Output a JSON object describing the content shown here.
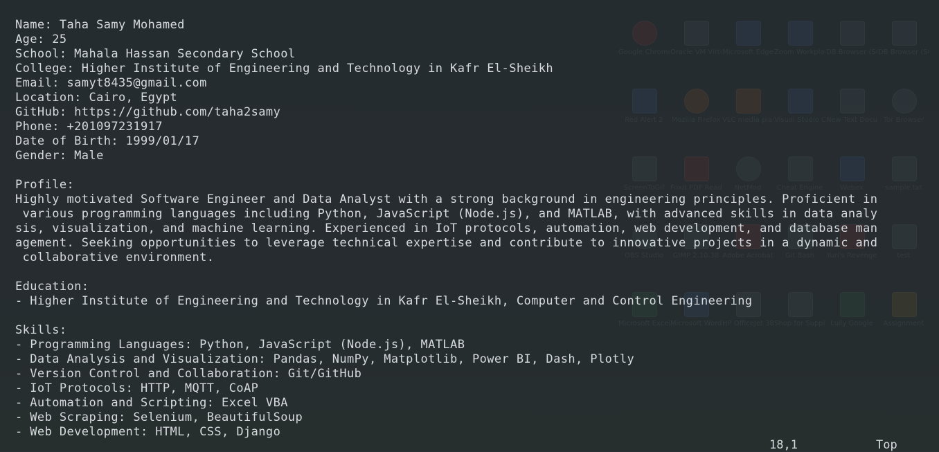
{
  "document": {
    "lines": [
      "Name: Taha Samy Mohamed",
      "Age: 25",
      "School: Mahala Hassan Secondary School",
      "College: Higher Institute of Engineering and Technology in Kafr El-Sheikh",
      "Email: samyt8435@gmail.com",
      "Location: Cairo, Egypt",
      "GitHub: https://github.com/taha2samy",
      "Phone: +201097231917",
      "Date of Birth: 1999/01/17",
      "Gender: Male",
      "",
      "Profile:",
      "Highly motivated Software Engineer and Data Analyst with a strong background in engineering principles. Proficient in",
      " various programming languages including Python, JavaScript (Node.js), and MATLAB, with advanced skills in data analy",
      "sis, visualization, and machine learning. Experienced in IoT protocols, automation, web development, and database man",
      "agement. Seeking opportunities to leverage technical expertise and contribute to innovative projects in a dynamic and",
      " collaborative environment.",
      "",
      "Education:",
      "- Higher Institute of Engineering and Technology in Kafr El-Sheikh, Computer and Control Engineering",
      "",
      "Skills:",
      "- Programming Languages: Python, JavaScript (Node.js), MATLAB",
      "- Data Analysis and Visualization: Pandas, NumPy, Matplotlib, Power BI, Dash, Plotly",
      "- Version Control and Collaboration: Git/GitHub",
      "- IoT Protocols: HTTP, MQTT, CoAP",
      "- Automation and Scripting: Excel VBA",
      "- Web Scraping: Selenium, BeautifulSoup",
      "- Web Development: HTML, CSS, Django"
    ]
  },
  "status": {
    "cursor_position": "18,1",
    "scroll_position": "Top"
  },
  "desktop_icons": [
    {
      "label": "Google Chrome",
      "icon": "chrome-icon",
      "color": "#d9443a"
    },
    {
      "label": "Oracle VM VirtualBox",
      "icon": "virtualbox-icon",
      "color": "#7a8a99"
    },
    {
      "label": "Microsoft Edge",
      "icon": "edge-icon",
      "color": "#2b7fd6"
    },
    {
      "label": "Zoom Workplace",
      "icon": "zoom-icon",
      "color": "#2d8cff"
    },
    {
      "label": "DB Browser (SQLCipher)",
      "icon": "dbbrowser-icon",
      "color": "#8895a0"
    },
    {
      "label": "DB Browser (SQLite)",
      "icon": "dbbrowser-icon",
      "color": "#8895a0"
    },
    {
      "label": "Red Alert 2",
      "icon": "game-icon",
      "color": "#3a6fb0"
    },
    {
      "label": "Mozilla Firefox",
      "icon": "firefox-icon",
      "color": "#e66a1e"
    },
    {
      "label": "VLC media player",
      "icon": "vlc-icon",
      "color": "#f08a00"
    },
    {
      "label": "Visual Studio Code",
      "icon": "vscode-icon",
      "color": "#2a7ac0"
    },
    {
      "label": "New Text Document",
      "icon": "textfile-icon",
      "color": "#c8ccd0"
    },
    {
      "label": "Tor Browser",
      "icon": "tor-icon",
      "color": "#7e4bb0"
    },
    {
      "label": "ScreenToGif",
      "icon": "screentogif-icon",
      "color": "#c8ccd0"
    },
    {
      "label": "Foxit PDF Reader",
      "icon": "foxit-icon",
      "color": "#e04a2a"
    },
    {
      "label": "NetMod",
      "icon": "netmod-icon",
      "color": "#c8ccd0"
    },
    {
      "label": "Cheat Engine",
      "icon": "cheatengine-icon",
      "color": "#5a7a9a"
    },
    {
      "label": "Webex",
      "icon": "webex-icon",
      "color": "#2aa0d8"
    },
    {
      "label": "sample.txt",
      "icon": "textfile-icon",
      "color": "#c8ccd0"
    },
    {
      "label": "OBS Studio",
      "icon": "obs-icon",
      "color": "#404850"
    },
    {
      "label": "GIMP 2.10.38",
      "icon": "gimp-icon",
      "color": "#7a6a50"
    },
    {
      "label": "Adobe Acrobat",
      "icon": "acrobat-icon",
      "color": "#d43a2a"
    },
    {
      "label": "Git Bash",
      "icon": "gitbash-icon",
      "color": "#c8ccd0"
    },
    {
      "label": "Yuri's Revenge",
      "icon": "game-icon",
      "color": "#b03030"
    },
    {
      "label": "test",
      "icon": "file-icon",
      "color": "#c8ccd0"
    },
    {
      "label": "Microsoft Excel",
      "icon": "excel-icon",
      "color": "#217346"
    },
    {
      "label": "Microsoft Word",
      "icon": "word-icon",
      "color": "#2b579a"
    },
    {
      "label": "HP OfficeJet 3830 series",
      "icon": "printer-icon",
      "color": "#c8ccd0"
    },
    {
      "label": "Shop for Supplies",
      "icon": "printer-icon",
      "color": "#c8ccd0"
    },
    {
      "label": "Lully Google",
      "icon": "maps-icon",
      "color": "#34a853"
    },
    {
      "label": "Assignment",
      "icon": "zip-icon",
      "color": "#d8b030"
    }
  ]
}
